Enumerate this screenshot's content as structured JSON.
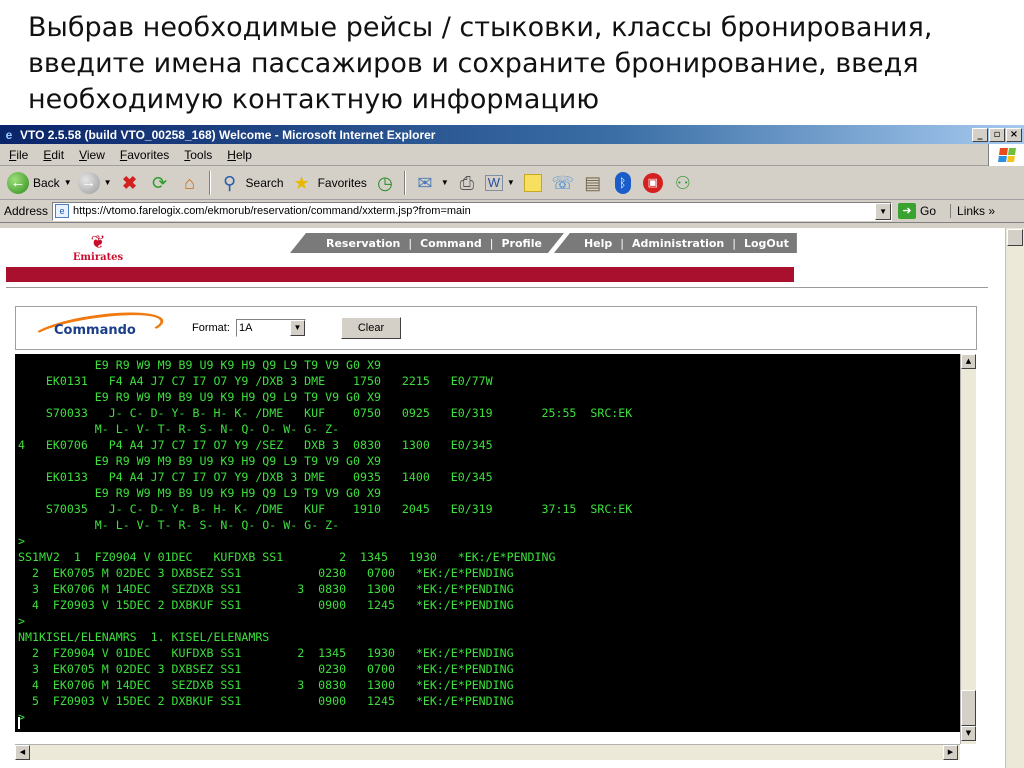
{
  "slide": {
    "heading": "Выбрав необходимые рейсы / стыковки, классы бронирования, введите имена пассажиров и сохраните бронирование, введя необходимую контактную информацию"
  },
  "window": {
    "title": "VTO 2.5.58 (build VTO_00258_168) Welcome - Microsoft Internet Explorer",
    "controls": [
      "_",
      "▫",
      "×"
    ]
  },
  "menubar": {
    "items": [
      "File",
      "Edit",
      "View",
      "Favorites",
      "Tools",
      "Help"
    ]
  },
  "toolbar": {
    "back_label": "Back",
    "search_label": "Search",
    "favorites_label": "Favorites"
  },
  "addressbar": {
    "label": "Address",
    "url": "https://vtomo.farelogix.com/ekmorub/reservation/command/xxterm.jsp?from=main",
    "go_label": "Go",
    "links_label": "Links"
  },
  "site": {
    "brand": "Emirates",
    "nav_left": [
      "Reservation",
      "Command",
      "Profile"
    ],
    "nav_right": [
      "Help",
      "Administration",
      "LogOut"
    ],
    "colors": {
      "brand_red": "#a8102e",
      "nav_grey": "#7a7a7a",
      "terminal_green": "#3ce03c"
    }
  },
  "commando": {
    "logo_text": "Commando",
    "format_label": "Format:",
    "format_value": "1A",
    "clear_label": "Clear"
  },
  "terminal": {
    "lines": [
      "           E9 R9 W9 M9 B9 U9 K9 H9 Q9 L9 T9 V9 G0 X9",
      "    EK0131   F4 A4 J7 C7 I7 O7 Y9 /DXB 3 DME    1750   2215   E0/77W",
      "           E9 R9 W9 M9 B9 U9 K9 H9 Q9 L9 T9 V9 G0 X9",
      "    S70033   J- C- D- Y- B- H- K- /DME   KUF    0750   0925   E0/319       25:55  SRC:EK",
      "           M- L- V- T- R- S- N- Q- O- W- G- Z-",
      "4   EK0706   P4 A4 J7 C7 I7 O7 Y9 /SEZ   DXB 3  0830   1300   E0/345",
      "           E9 R9 W9 M9 B9 U9 K9 H9 Q9 L9 T9 V9 G0 X9",
      "    EK0133   P4 A4 J7 C7 I7 O7 Y9 /DXB 3 DME    0935   1400   E0/345",
      "           E9 R9 W9 M9 B9 U9 K9 H9 Q9 L9 T9 V9 G0 X9",
      "    S70035   J- C- D- Y- B- H- K- /DME   KUF    1910   2045   E0/319       37:15  SRC:EK",
      "           M- L- V- T- R- S- N- Q- O- W- G- Z-",
      ">",
      "SS1MV2  1  FZ0904 V 01DEC   KUFDXB SS1        2  1345   1930   *EK:/E*PENDING",
      "  2  EK0705 M 02DEC 3 DXBSEZ SS1           0230   0700   *EK:/E*PENDING",
      "  3  EK0706 M 14DEC   SEZDXB SS1        3  0830   1300   *EK:/E*PENDING",
      "  4  FZ0903 V 15DEC 2 DXBKUF SS1           0900   1245   *EK:/E*PENDING",
      ">",
      "NM1KISEL/ELENAMRS  1. KISEL/ELENAMRS",
      "  2  FZ0904 V 01DEC   KUFDXB SS1        2  1345   1930   *EK:/E*PENDING",
      "  3  EK0705 M 02DEC 3 DXBSEZ SS1           0230   0700   *EK:/E*PENDING",
      "  4  EK0706 M 14DEC   SEZDXB SS1        3  0830   1300   *EK:/E*PENDING",
      "  5  FZ0903 V 15DEC 2 DXBKUF SS1           0900   1245   *EK:/E*PENDING",
      ">"
    ]
  }
}
